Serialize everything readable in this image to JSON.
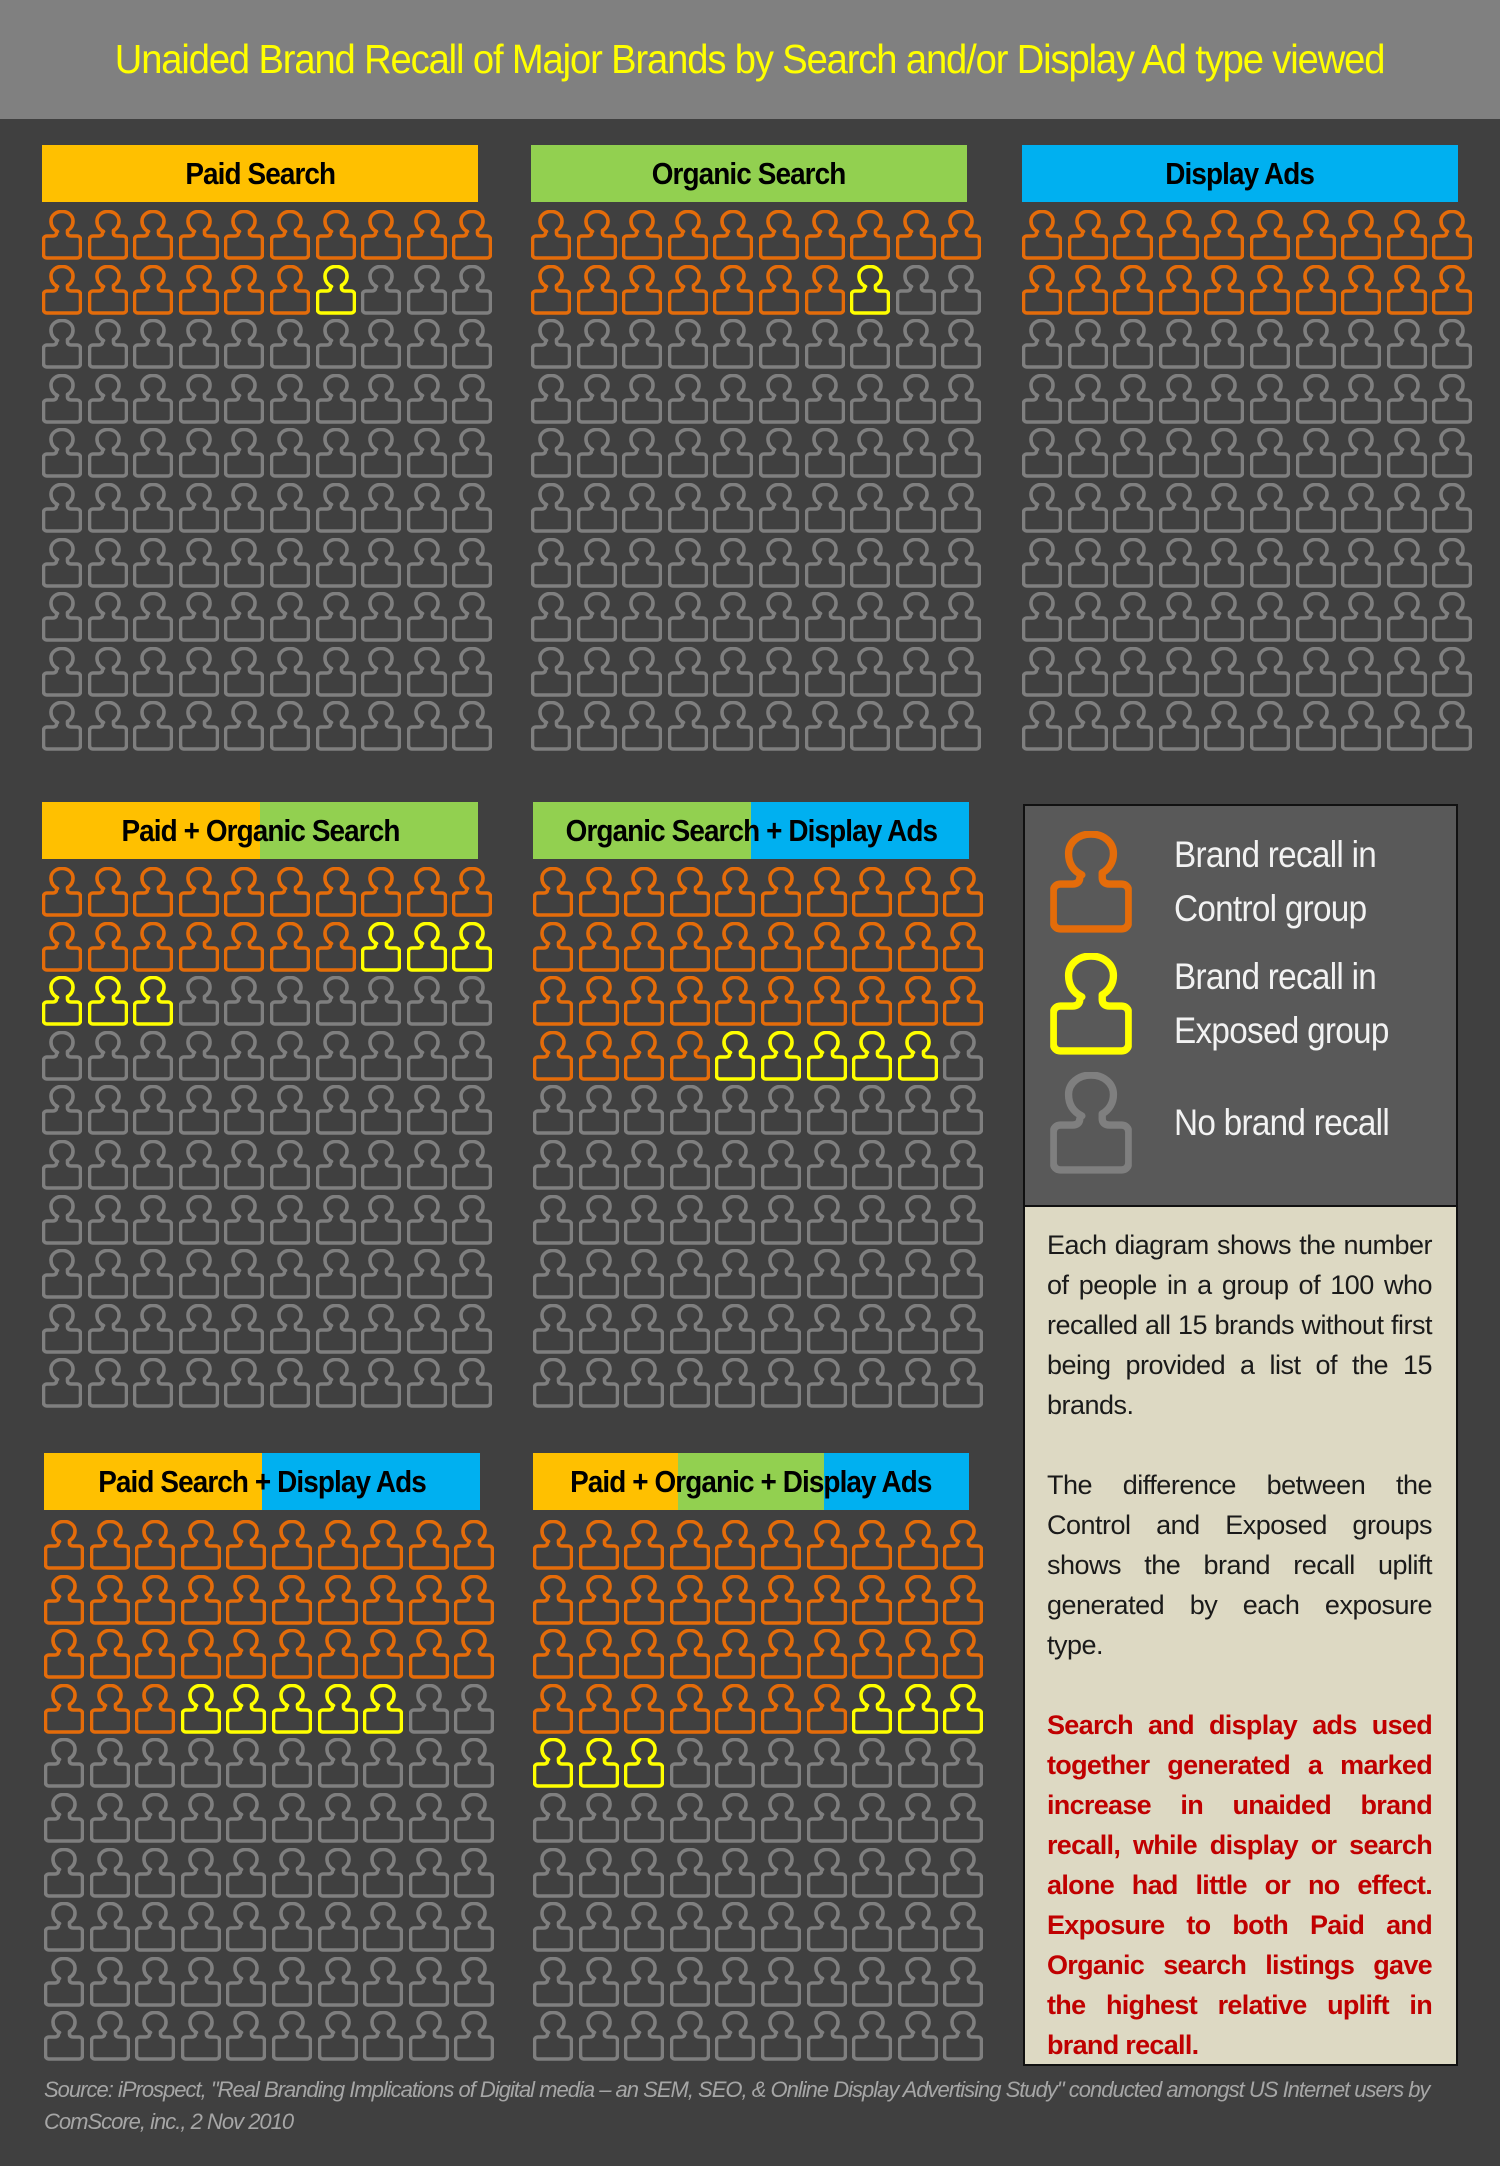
{
  "title": "Unaided Brand Recall of Major Brands by Search and/or Display Ad type viewed",
  "colors": {
    "background": "#404040",
    "header": "#808080",
    "title": "#ffff00",
    "paid": "#ffc000",
    "organic": "#92d050",
    "display": "#00b0f0",
    "control": "#e46c0a",
    "exposed": "#ffff00",
    "none": "#7f7f7f",
    "note_bg": "#ddd9c3",
    "note_red": "#c00000"
  },
  "legend": {
    "control": "Brand recall in\nControl group",
    "exposed": "Brand recall in\nExposed group",
    "none": "No brand recall"
  },
  "notes": {
    "p1": "Each diagram shows the number of people in a group of 100 who recalled all 15 brands without first being provided a list of the 15 brands.",
    "p2": "The difference between the Control and Exposed groups shows the brand recall uplift generated by each exposure type.",
    "p3": "Search and display ads used together generated a marked increase in unaided brand recall, while display or search alone had little or no effect. Exposure to both Paid and Organic search listings gave the highest relative uplift in brand recall."
  },
  "source": "Source: iProspect, \"Real Branding Implications of Digital media – an SEM, SEO, & Online Display Advertising Study\" conducted amongst US Internet users by ComScore, inc., 2 Nov 2010",
  "chart_data": {
    "type": "pictogram",
    "title": "Unaided Brand Recall of Major Brands by Search and/or Display Ad type viewed",
    "group_size": 100,
    "units": "people per 100",
    "legend": [
      "Brand recall in Control group",
      "Brand recall in Exposed group",
      "No brand recall"
    ],
    "legend_placement": "right",
    "panels": [
      {
        "label": "Paid Search",
        "label_parts": [
          "paid"
        ],
        "control": 16,
        "exposed_uplift": 1
      },
      {
        "label": "Organic Search",
        "label_parts": [
          "organic"
        ],
        "control": 17,
        "exposed_uplift": 1
      },
      {
        "label": "Display Ads",
        "label_parts": [
          "display"
        ],
        "control": 20,
        "exposed_uplift": 0
      },
      {
        "label": "Paid + Organic Search",
        "label_parts": [
          "paid",
          "organic"
        ],
        "control": 17,
        "exposed_uplift": 6
      },
      {
        "label": "Organic Search + Display Ads",
        "label_parts": [
          "organic",
          "display"
        ],
        "control": 34,
        "exposed_uplift": 5
      },
      {
        "label": "Paid Search + Display Ads",
        "label_parts": [
          "paid",
          "display"
        ],
        "control": 33,
        "exposed_uplift": 5
      },
      {
        "label": "Paid + Organic + Display Ads",
        "label_parts": [
          "paid",
          "organic",
          "display"
        ],
        "control": 37,
        "exposed_uplift": 6
      }
    ]
  }
}
